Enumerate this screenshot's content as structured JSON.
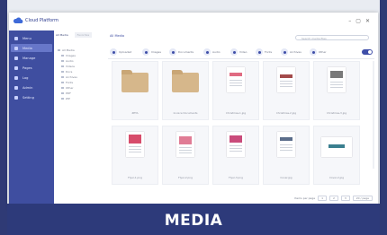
{
  "app": {
    "name": "Cloud Platform"
  },
  "sidebar": {
    "items": [
      {
        "label": "Menu"
      },
      {
        "label": "Media"
      },
      {
        "label": "Manage"
      },
      {
        "label": "Pages"
      },
      {
        "label": "Log"
      },
      {
        "label": "Admin"
      },
      {
        "label": "Setting"
      }
    ]
  },
  "tree": {
    "tabs": [
      "All Media",
      "Favorites"
    ],
    "items": [
      "All Media",
      "Images",
      "Audio",
      "Videos",
      "Docs",
      "Archives",
      "Fonts",
      "Other",
      "PDF",
      "ZIP"
    ]
  },
  "main": {
    "breadcrumb": "All Media",
    "search_placeholder": "Search media files",
    "filters": [
      "Uploaded",
      "Images",
      "Documents",
      "Audio",
      "Video",
      "Fonts",
      "Archives",
      "Other"
    ]
  },
  "media": [
    {
      "name": "ZETA",
      "kind": "folder"
    },
    {
      "name": "Invoice Documents",
      "kind": "folder"
    },
    {
      "name": "Christmas-1.jpg",
      "kind": "doc",
      "accent": "#e06b82"
    },
    {
      "name": "Christmas-2.jpg",
      "kind": "doc",
      "accent": "#a34a4a"
    },
    {
      "name": "Christmas-3.jpg",
      "kind": "doc",
      "accent": "#7a7a7a"
    },
    {
      "name": "Flyer-1.png",
      "kind": "doc",
      "accent": "#d74c6b"
    },
    {
      "name": "Flyer-2.png",
      "kind": "doc",
      "accent": "#e07c95"
    },
    {
      "name": "Flyer-3.png",
      "kind": "doc",
      "accent": "#c94b7b"
    },
    {
      "name": "Cover.jpg",
      "kind": "doc",
      "accent": "#5b6d8a"
    },
    {
      "name": "Cover-2.jpg",
      "kind": "doc",
      "accent": "#3a7f8f"
    }
  ],
  "pager": {
    "label": "Items per page",
    "pages": [
      "1",
      "2",
      "3"
    ],
    "per_page": "20 / page"
  },
  "banner": {
    "title": "MEDIA"
  },
  "colors": {
    "sidebar": "#3f4ea0",
    "accent": "#3e4ea8",
    "frame": "#2d3a7a"
  }
}
